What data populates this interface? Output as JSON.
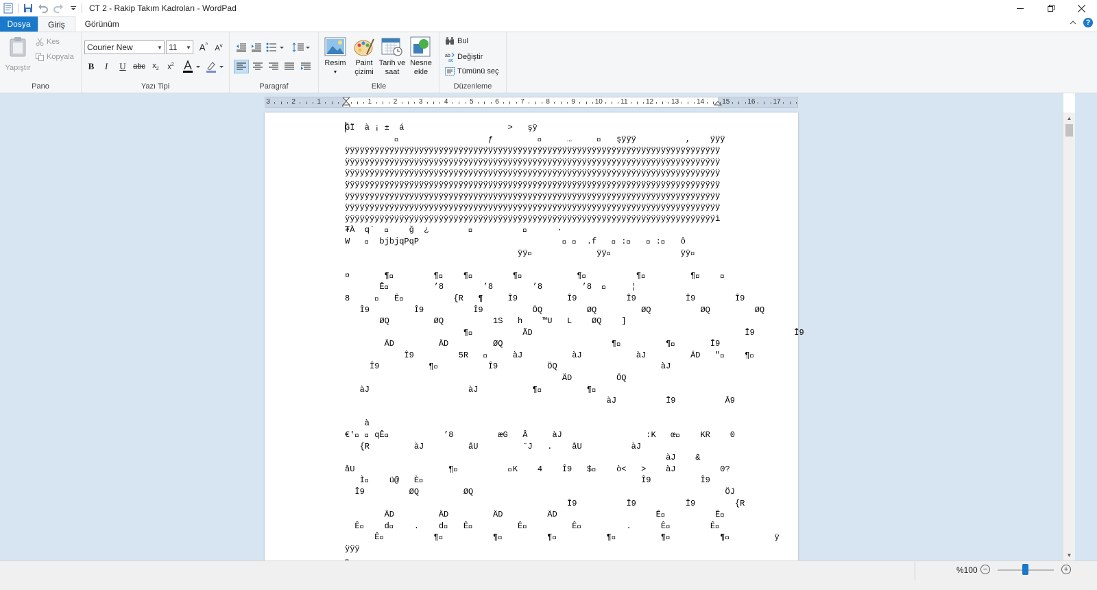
{
  "window": {
    "title": "CT 2 - Rakip Takım Kadroları - WordPad"
  },
  "tabs": {
    "file": "Dosya",
    "home": "Giriş",
    "view": "Görünüm"
  },
  "ribbon": {
    "clipboard": {
      "group_label": "Pano",
      "paste": "Yapıştır",
      "cut": "Kes",
      "copy": "Kopyala"
    },
    "font": {
      "group_label": "Yazı Tipi",
      "family": "Courier New",
      "size": "11"
    },
    "paragraph": {
      "group_label": "Paragraf"
    },
    "insert": {
      "group_label": "Ekle",
      "picture": "Resim",
      "paint_line1": "Paint",
      "paint_line2": "çizimi",
      "datetime_line1": "Tarih ve",
      "datetime_line2": "saat",
      "object_line1": "Nesne",
      "object_line2": "ekle"
    },
    "editing": {
      "group_label": "Düzenleme",
      "find": "Bul",
      "replace": "Değiştir",
      "select_all": "Tümünü seç"
    }
  },
  "ruler": {
    "labels": [
      "3",
      "2",
      "1",
      "",
      "1",
      "2",
      "3",
      "4",
      "5",
      "6",
      "7",
      "8",
      "9",
      "10",
      "11",
      "12",
      "13",
      "14",
      "15",
      "16",
      "17"
    ]
  },
  "document": {
    "text": "ĞÏ  à ¡ ±  á                     >   şÿ\n          \u0000                  ƒ         \u0000     …     \u0000   şÿÿÿ          ,    ÿÿÿ\nÿÿÿÿÿÿÿÿÿÿÿÿÿÿÿÿÿÿÿÿÿÿÿÿÿÿÿÿÿÿÿÿÿÿÿÿÿÿÿÿÿÿÿÿÿÿÿÿÿÿÿÿÿÿÿÿÿÿÿÿÿÿÿÿÿÿÿÿÿÿÿÿÿÿÿÿ\nÿÿÿÿÿÿÿÿÿÿÿÿÿÿÿÿÿÿÿÿÿÿÿÿÿÿÿÿÿÿÿÿÿÿÿÿÿÿÿÿÿÿÿÿÿÿÿÿÿÿÿÿÿÿÿÿÿÿÿÿÿÿÿÿÿÿÿÿÿÿÿÿÿÿÿÿ\nÿÿÿÿÿÿÿÿÿÿÿÿÿÿÿÿÿÿÿÿÿÿÿÿÿÿÿÿÿÿÿÿÿÿÿÿÿÿÿÿÿÿÿÿÿÿÿÿÿÿÿÿÿÿÿÿÿÿÿÿÿÿÿÿÿÿÿÿÿÿÿÿÿÿÿÿ\nÿÿÿÿÿÿÿÿÿÿÿÿÿÿÿÿÿÿÿÿÿÿÿÿÿÿÿÿÿÿÿÿÿÿÿÿÿÿÿÿÿÿÿÿÿÿÿÿÿÿÿÿÿÿÿÿÿÿÿÿÿÿÿÿÿÿÿÿÿÿÿÿÿÿÿÿ\nÿÿÿÿÿÿÿÿÿÿÿÿÿÿÿÿÿÿÿÿÿÿÿÿÿÿÿÿÿÿÿÿÿÿÿÿÿÿÿÿÿÿÿÿÿÿÿÿÿÿÿÿÿÿÿÿÿÿÿÿÿÿÿÿÿÿÿÿÿÿÿÿÿÿÿÿ\nÿÿÿÿÿÿÿÿÿÿÿÿÿÿÿÿÿÿÿÿÿÿÿÿÿÿÿÿÿÿÿÿÿÿÿÿÿÿÿÿÿÿÿÿÿÿÿÿÿÿÿÿÿÿÿÿÿÿÿÿÿÿÿÿÿÿÿÿÿÿÿÿÿÿÿÿ\nÿÿÿÿÿÿÿÿÿÿÿÿÿÿÿÿÿÿÿÿÿÿÿÿÿÿÿÿÿÿÿÿÿÿÿÿÿÿÿÿÿÿÿÿÿÿÿÿÿÿÿÿÿÿÿÿÿÿÿÿÿÿÿÿÿÿÿÿÿÿÿÿÿÿÿì\n₮À  q`  \u0000    ğ  ¿        \u0000          \u0000      ·\nW   \u0000  bjbjqPqP                             \u0000 \u0000  .f   \u0000 :\u0000   \u0000 :\u0000   ô\n                                   ÿÿ\u0000             ÿÿ\u0000              ÿÿ\u0000\n\n¤       ¶\u0000        ¶\u0000    ¶\u0000        ¶\u0000           ¶\u0000          ¶\u0000         ¶\u0000    \u0000\n       Ê\u0000         ’8        ’8        ’8        ’8  \u0000     ¦\n8     \u0000   Ê\u0000          {R   ¶     Î9          Î9          Î9          Î9        Î9\n   Î9         Î9          Î9          ÖQ         ØQ         ØQ          ØQ         ØQ\n       ØQ         ØQ          1S   h    ™U   L    ØQ    ]\n                        ¶\u0000          ÃD                                           Î9        Î9\n        ÄD         ÄD         ØQ                      ¶\u0000         ¶\u0000       Î9\n            Î9         5R   \u0000     àJ          àJ           àJ         ÄD   \"\u0000    ¶\u0000\n     Î9          ¶\u0000          Î9          ÖQ                     àJ\n                                            ÄD         ÖQ\n   àJ                    àJ           ¶\u0000         ¶\u0000\n                                                     àJ          Î9          Â9\n\n    à\n€'\u0000 \u0000 qÊ\u0000           ’8         æG   Â     àJ                 :K   œ\u0000    KR    0\n   {R         àJ         åU         ¨J   .    åU          àJ\n                                                                 àJ    &\nåU                   ¶\u0000          \u0000K    4    Î9   $\u0000    ò<   >    àJ         0?\n   Ì\u0000    ü@   È\u0000                                            Î9          Î9\n  Î9         ØQ         ØQ                                                   ÖJ\n                                             Î9          Î9          Î9        {R\n        ÄD         ÄD         ÄD         ÄD                    Ê\u0000          Ê\u0000\n  Ê\u0000    d\u0000    .    d\u0000   Ê\u0000         Ê\u0000         Ê\u0000         .      Ê\u0000        Ê\u0000\n      Ê\u0000          ¶\u0000          ¶\u0000         ¶\u0000          ¶\u0000         ¶\u0000          ¶\u0000         ÿ\nÿÿÿ\n\u0000"
  },
  "status": {
    "zoom": "%100",
    "zoom_level_percent": 100
  },
  "colors": {
    "accent": "#1979ca",
    "ribbon_bg": "#f5f6f7",
    "workspace_bg": "#d7e4f1"
  }
}
